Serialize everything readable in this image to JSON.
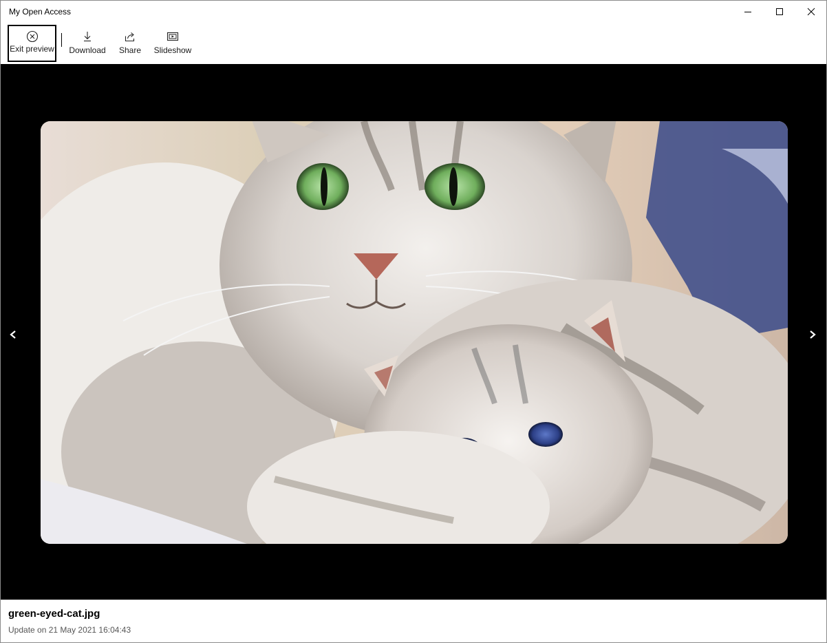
{
  "window": {
    "title": "My Open Access"
  },
  "toolbar": {
    "exit_preview": "Exit preview",
    "download": "Download",
    "share": "Share",
    "slideshow": "Slideshow"
  },
  "icons": {
    "exit": "circle-x-icon",
    "download": "download-arrow-icon",
    "share": "share-arrow-icon",
    "slideshow": "slideshow-icon",
    "prev": "chevron-left-icon",
    "next": "chevron-right-icon"
  },
  "nav": {
    "prev": "<",
    "next": ">"
  },
  "photo": {
    "subject": "photo-cat-and-kitten"
  },
  "file": {
    "name": "green-eyed-cat.jpg",
    "updated": "Update on 21 May 2021 16:04:43"
  },
  "colors": {
    "preview_background": "#000000",
    "window_background": "#ffffff",
    "focus_border": "#000000"
  }
}
